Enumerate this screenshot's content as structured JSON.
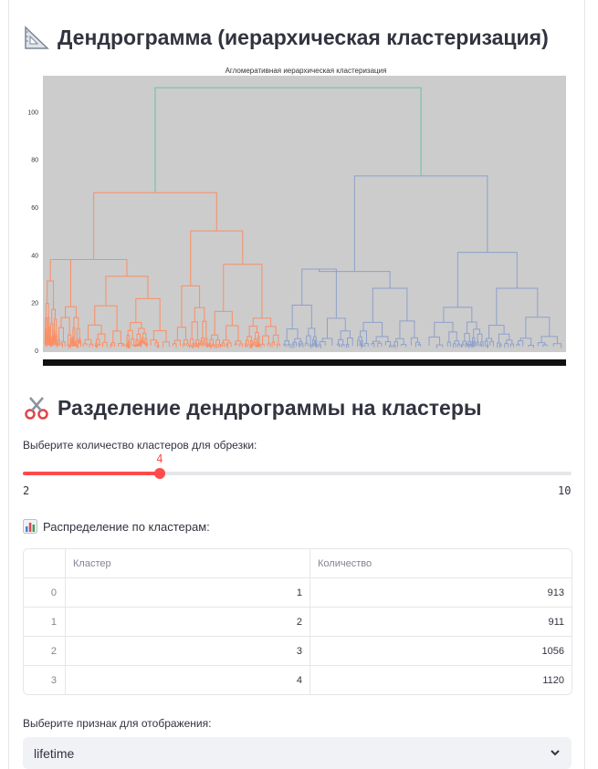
{
  "section1": {
    "title": "Дендрограмма (иерархическая кластеризация)",
    "icon": "triangular-ruler-icon"
  },
  "chart_data": {
    "type": "dendrogram",
    "title": "Агломеративная иерархическая кластеризация",
    "yticks": [
      "0",
      "20",
      "40",
      "60",
      "80",
      "100"
    ],
    "ylim": [
      0,
      115
    ],
    "background": "#cccccc",
    "colors": {
      "cluster_a": "#fc8d62",
      "cluster_b": "#8da0cb",
      "root": "#66c2a5"
    },
    "merges": [
      {
        "name": "root",
        "height": 110,
        "color": "root"
      },
      {
        "name": "left-top",
        "height": 66,
        "color": "cluster_a"
      },
      {
        "name": "right-top",
        "height": 73,
        "color": "cluster_b"
      },
      {
        "name": "right-sub",
        "height": 41,
        "color": "cluster_b"
      },
      {
        "name": "left-sub",
        "height": 50,
        "color": "cluster_a"
      }
    ]
  },
  "section2": {
    "title": "Разделение дендрограммы на кластеры",
    "icon": "scissors-icon"
  },
  "slider": {
    "label": "Выберите количество кластеров для обрезки:",
    "min": 2,
    "max": 10,
    "value": 4,
    "min_label": "2",
    "max_label": "10",
    "value_label": "4"
  },
  "distribution": {
    "label": "Распределение по кластерам:",
    "icon": "bar-chart-icon"
  },
  "table": {
    "headers": [
      "Кластер",
      "Количество"
    ],
    "rows": [
      {
        "idx": "0",
        "cluster": "1",
        "count": "913"
      },
      {
        "idx": "1",
        "cluster": "2",
        "count": "911"
      },
      {
        "idx": "2",
        "cluster": "3",
        "count": "1056"
      },
      {
        "idx": "3",
        "cluster": "4",
        "count": "1120"
      }
    ]
  },
  "feature_select": {
    "label": "Выберите признак для отображения:",
    "value": "lifetime",
    "icon": "chevron-down-icon"
  }
}
